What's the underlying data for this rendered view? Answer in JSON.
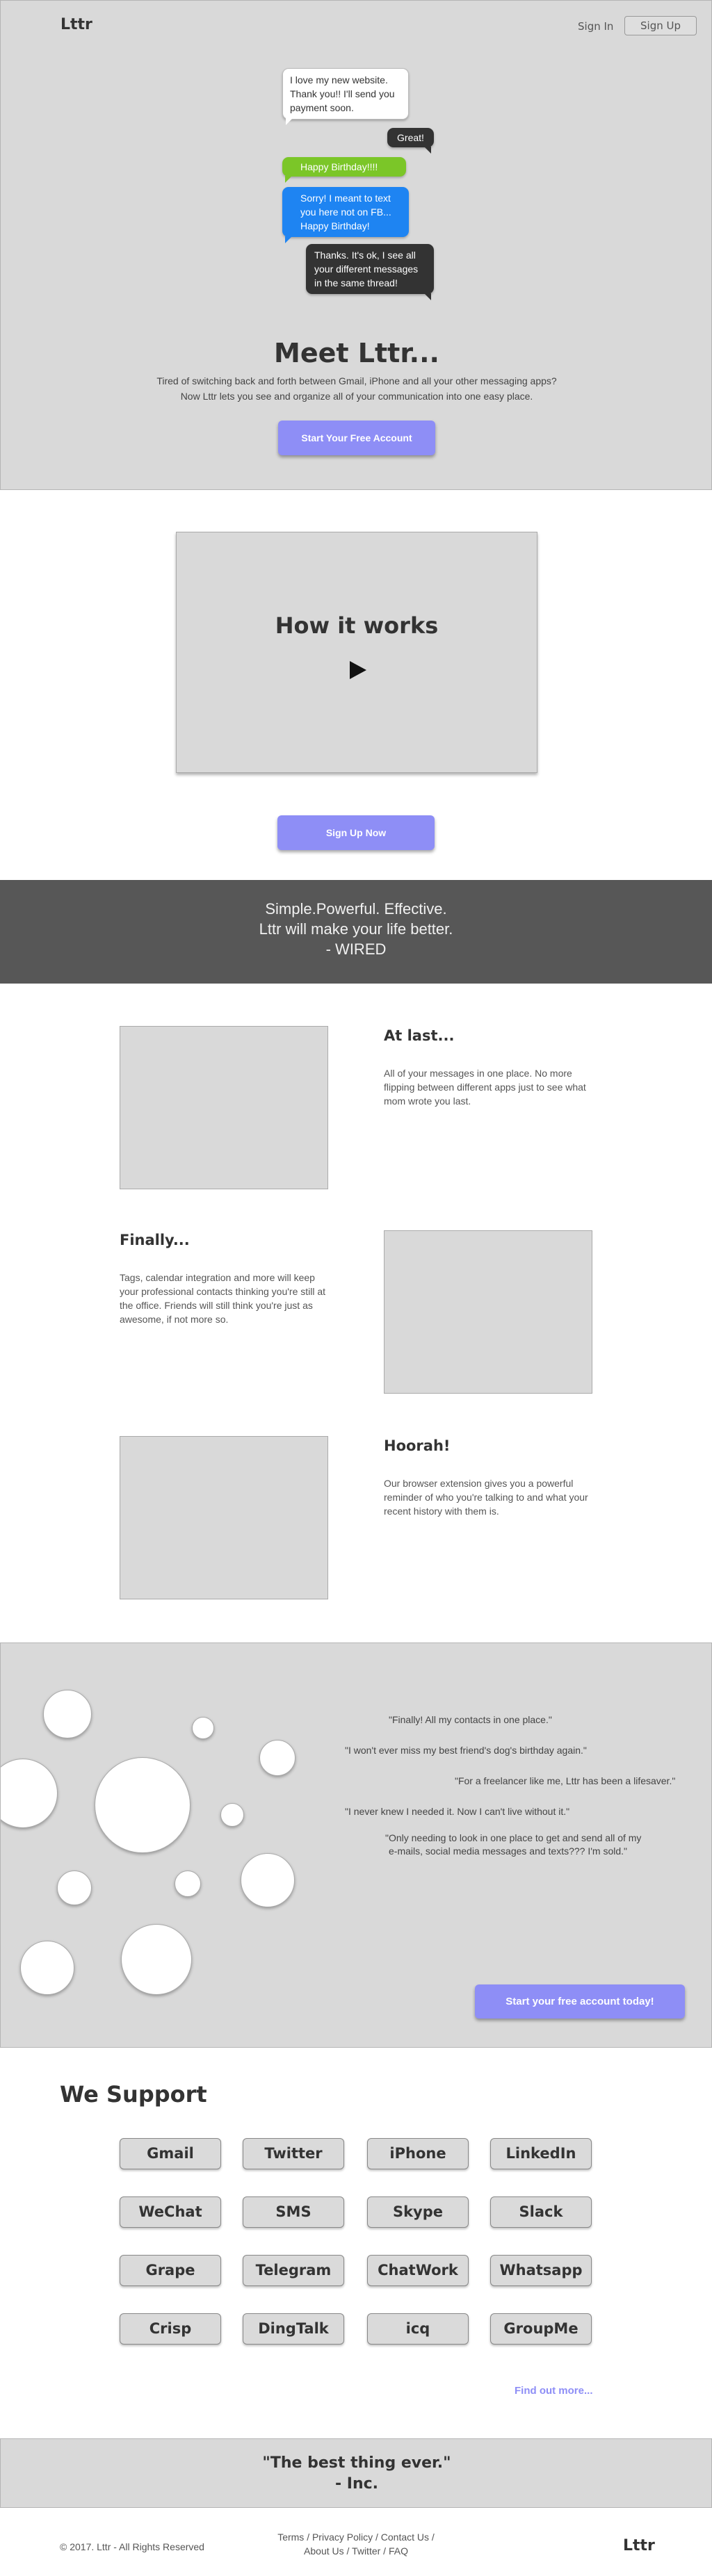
{
  "header": {
    "logo": "Lttr",
    "sign_in": "Sign In",
    "sign_up": "Sign Up"
  },
  "hero": {
    "messages": [
      "I love my new website. Thank you!! I'll send you payment soon.",
      "Great!",
      "Happy Birthday!!!!",
      "Sorry! I meant to text you here not on FB... Happy Birthday!",
      "Thanks. It's ok, I see all your different messages in the same thread!"
    ],
    "title": "Meet Lttr...",
    "subtitle_line1": "Tired of switching back and forth between Gmail, iPhone and all your other messaging apps?",
    "subtitle_line2": "Now Lttr lets you see and organize all of your communication into one easy place.",
    "cta": "Start Your Free Account"
  },
  "video": {
    "title": "How it works"
  },
  "signup_cta": "Sign Up Now",
  "press_quote": {
    "line1": "Simple.Powerful. Effective.",
    "line2": "Lttr will make your life better.",
    "line3": "- WIRED"
  },
  "features": [
    {
      "title": "At last...",
      "text": "All of your messages in one place. No more flipping between different apps just to see what mom wrote you last."
    },
    {
      "title": "Finally...",
      "text": "Tags, calendar integration and more will keep your professional contacts thinking you're still at the office. Friends will still think you're just as awesome, if not more so."
    },
    {
      "title": "Hoorah!",
      "text": "Our browser extension gives you a powerful reminder of who you're talking to and what your recent history with them is."
    }
  ],
  "testimonials": [
    "\"Finally! All my contacts in one place.\"",
    "\"I won't ever miss my best friend's dog's birthday again.\"",
    "\"For a freelancer like me, Lttr has been a lifesaver.\"",
    "\"I never knew I needed it. Now I can't live without it.\"",
    "\"Only needing to look in one place to get and send all of my",
    "e-mails, social media messages and texts??? I'm sold.\""
  ],
  "testimonials_cta": "Start your free account today!",
  "support": {
    "title": "We Support",
    "services": [
      "Gmail",
      "Twitter",
      "iPhone",
      "LinkedIn",
      "WeChat",
      "SMS",
      "Skype",
      "Slack",
      "Grape",
      "Telegram",
      "ChatWork",
      "Whatsapp",
      "Crisp",
      "DingTalk",
      "icq",
      "GroupMe"
    ],
    "find_more": "Find out more..."
  },
  "best_quote": {
    "line1": "\"The best thing ever.\"",
    "line2": "- Inc."
  },
  "footer": {
    "copyright": "© 2017. Lttr - All Rights Reserved",
    "links_line1": "Terms / Privacy Policy / Contact Us /",
    "links_line2": "About Us  / Twitter / FAQ",
    "logo": "Lttr"
  },
  "colors": {
    "accent": "#8e8ef6",
    "hero_bg": "#d9d9d9",
    "quote_bar_bg": "#575757",
    "bubble_green": "#7bc628",
    "bubble_blue": "#1e84f2",
    "bubble_dark": "#333333"
  }
}
